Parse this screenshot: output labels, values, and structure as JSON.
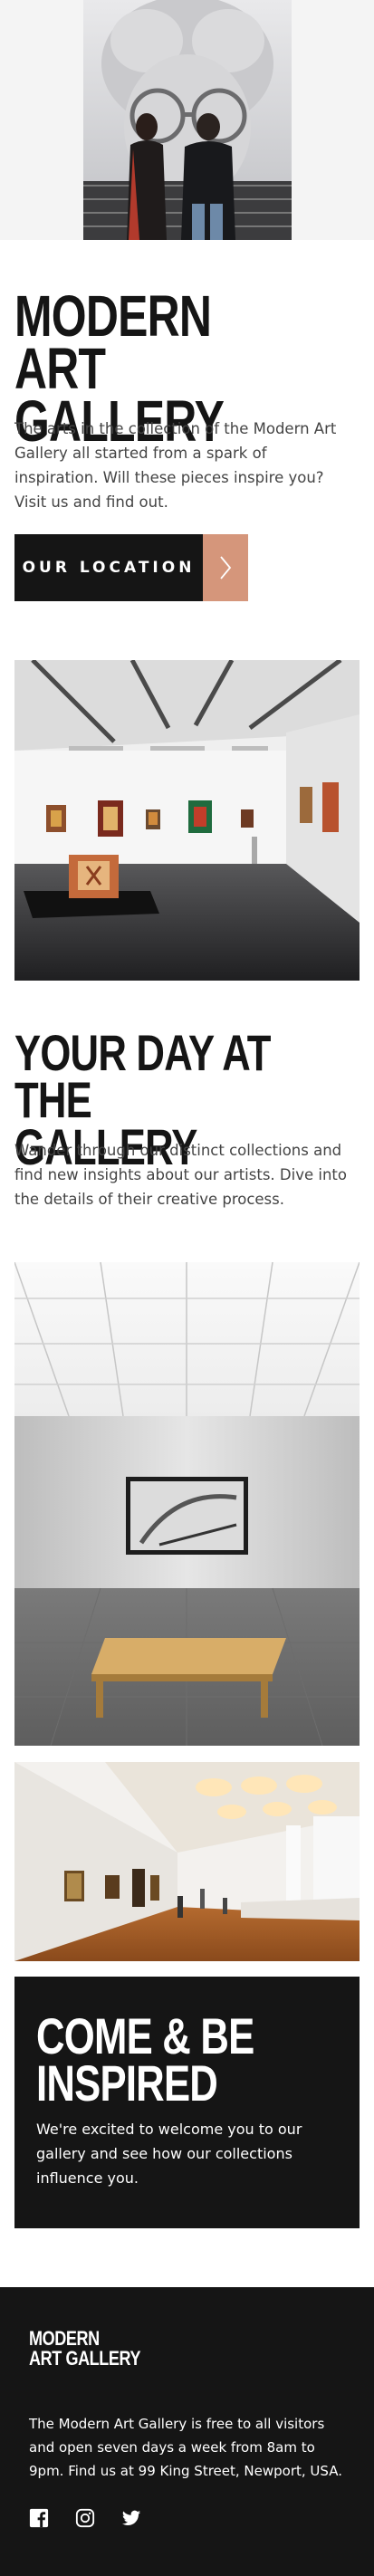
{
  "hero": {
    "image": "gallery-visitors-viewing-portrait-photo"
  },
  "intro": {
    "title_line1": "Modern",
    "title_line2": "Art Gallery",
    "text": "The arts in the collection of the Modern Art Gallery all started from a spark of inspiration. Will these pieces inspire you? Visit us and find out.",
    "cta_label": "OUR LOCATION",
    "cta_icon": "chevron-right-icon",
    "accent_color": "#d5967b"
  },
  "gallery_image": "gallery-hall-interior-photo",
  "your_day": {
    "title_line1": "Your Day at the",
    "title_line2": "Gallery",
    "text": "Wander through our distinct collections and find new insights about our artists. Dive into the details of their creative process."
  },
  "images": {
    "bench": "gallery-room-with-bench-photo",
    "wide_room": "wide-gallery-room-photo"
  },
  "inspired": {
    "title_line1": "Come & Be",
    "title_line2": "Inspired",
    "text": "We're excited to welcome you to our gallery and see how our collections influence you."
  },
  "footer": {
    "logo_line1": "Modern",
    "logo_line2": "Art Gallery",
    "text": "The Modern Art Gallery is free to all visitors and open seven days a week from 8am to 9pm. Find us at 99 King Street, Newport, USA.",
    "social": [
      "facebook-icon",
      "instagram-icon",
      "twitter-icon"
    ]
  },
  "colors": {
    "dark": "#151515",
    "text": "#444444",
    "light_bg": "#f4f4f4"
  }
}
